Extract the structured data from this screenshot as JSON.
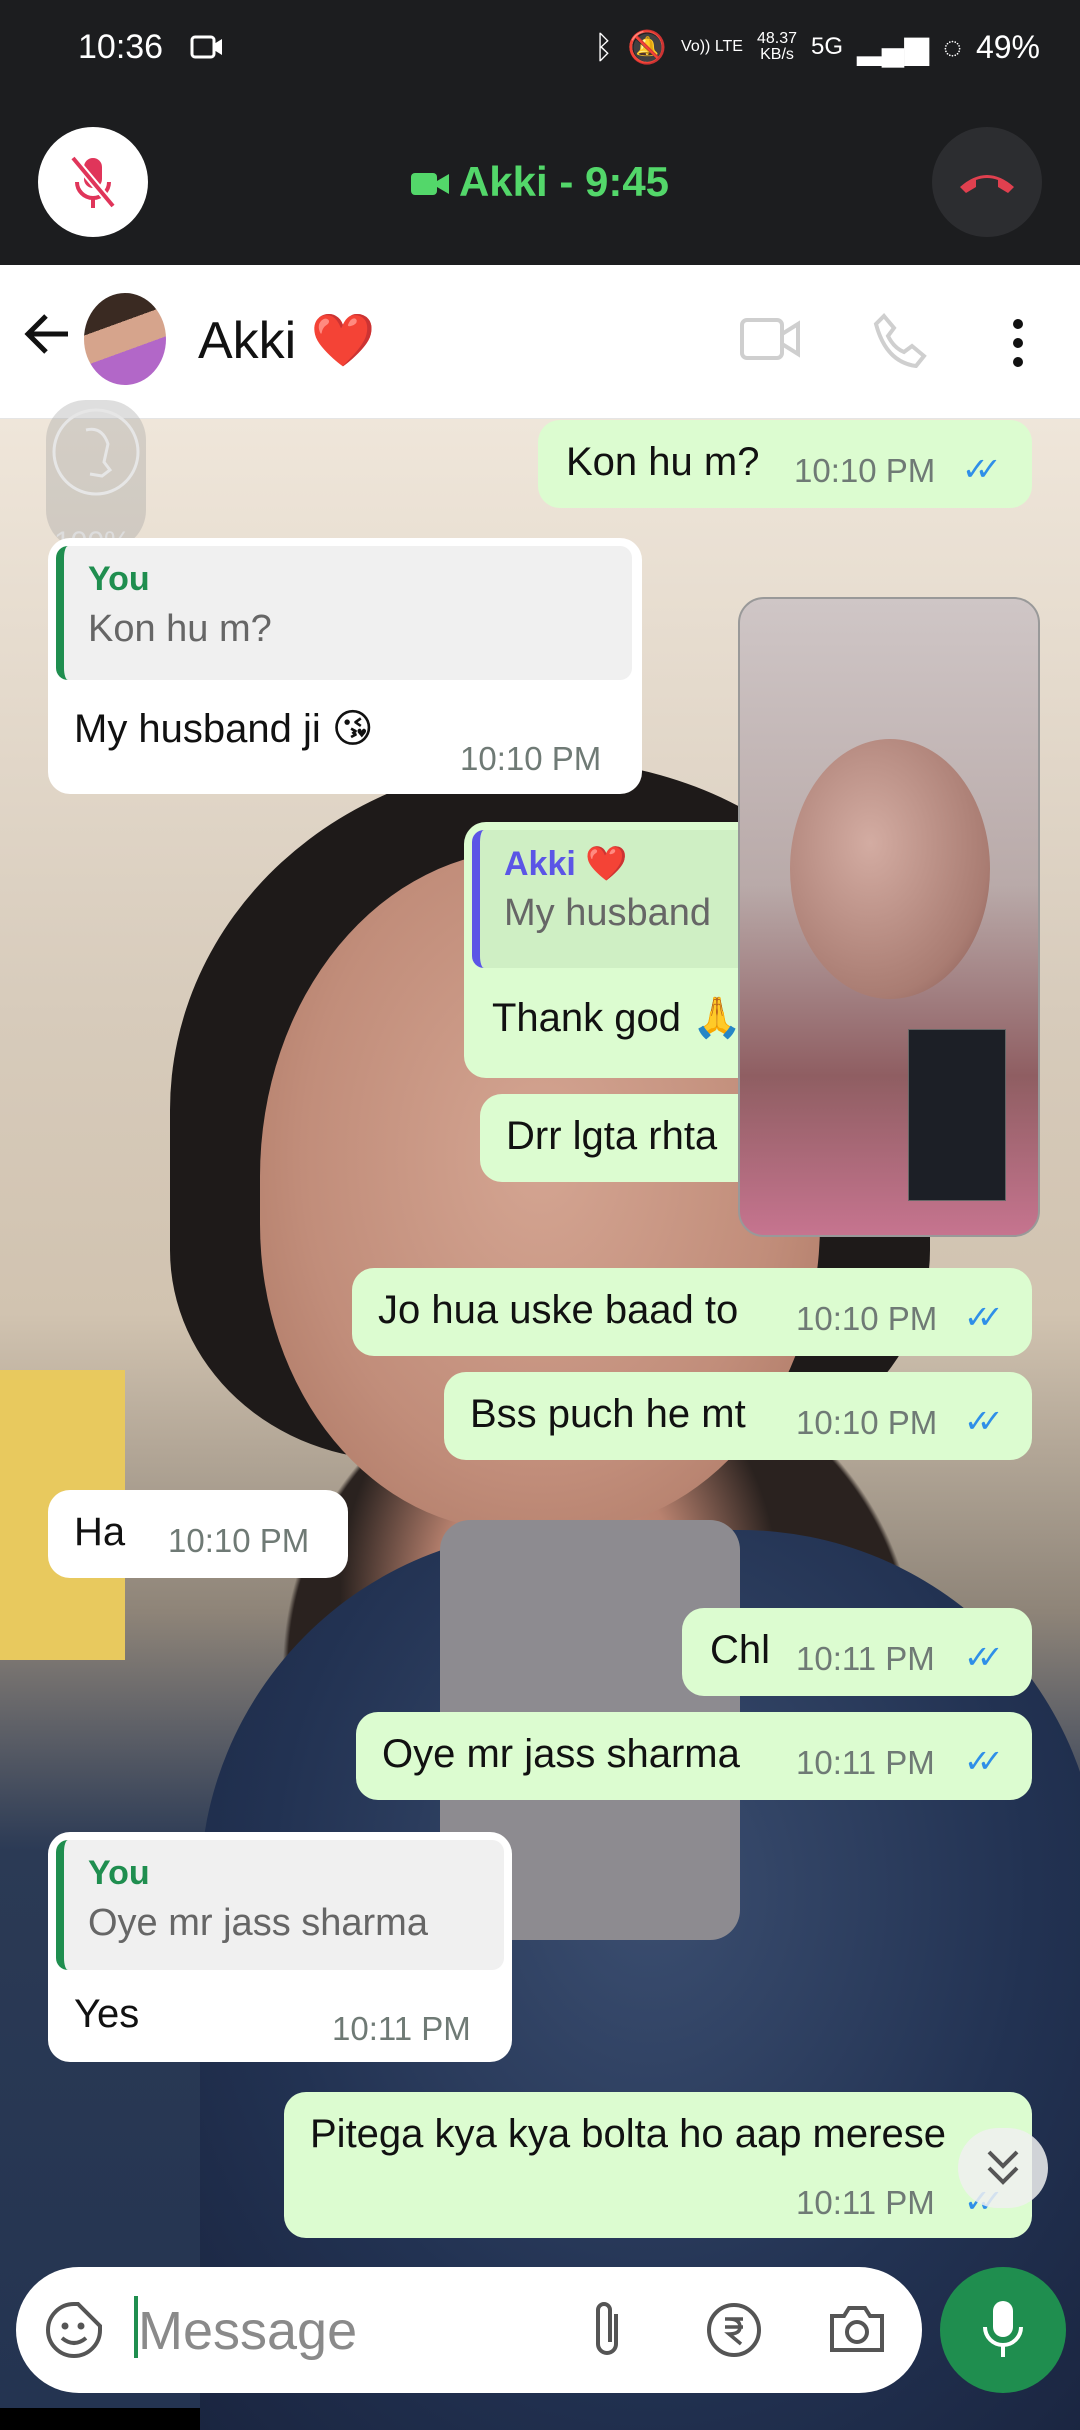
{
  "status_bar": {
    "time": "10:36",
    "network_speed_value": "48.37",
    "network_speed_unit": "KB/s",
    "network": "5G",
    "volte": "Vo)) LTE",
    "battery": "49%"
  },
  "call": {
    "title": "Akki - 9:45",
    "accent_color": "#53d76a"
  },
  "chat_header": {
    "contact_name": "Akki ❤️"
  },
  "overlay": {
    "filter_percent": "100%"
  },
  "messages": [
    {
      "dir": "out",
      "text": "Kon hu m?",
      "time": "10:10 PM",
      "ticks": "✓✓"
    },
    {
      "dir": "in",
      "quote_name": "You",
      "quote_text": "Kon hu m?",
      "text": "My husband ji 😘",
      "time": "10:10 PM"
    },
    {
      "dir": "out",
      "quote_name": "Akki ❤️",
      "quote_text": "My husband",
      "text": "Thank god 🙏"
    },
    {
      "dir": "out",
      "text": "Drr lgta rhta"
    },
    {
      "dir": "out",
      "text": "Jo hua uske baad to",
      "time": "10:10 PM",
      "ticks": "✓✓"
    },
    {
      "dir": "out",
      "text": "Bss puch he mt",
      "time": "10:10 PM",
      "ticks": "✓✓"
    },
    {
      "dir": "in",
      "text": "Ha",
      "time": "10:10 PM"
    },
    {
      "dir": "out",
      "text": "Chl",
      "time": "10:11 PM",
      "ticks": "✓✓"
    },
    {
      "dir": "out",
      "text": "Oye mr jass sharma",
      "time": "10:11 PM",
      "ticks": "✓✓"
    },
    {
      "dir": "in",
      "quote_name": "You",
      "quote_text": "Oye mr jass sharma",
      "text": "Yes",
      "time": "10:11 PM"
    },
    {
      "dir": "out",
      "text": "Pitega kya kya bolta ho aap merese",
      "time": "10:11 PM",
      "ticks": "✓✓"
    }
  ],
  "input": {
    "placeholder": "Message"
  },
  "colors": {
    "outgoing_bubble": "#dcfcd0",
    "incoming_bubble": "#ffffff",
    "whatsapp_green": "#1f8e4f",
    "tick_blue": "#2f8fe8"
  }
}
